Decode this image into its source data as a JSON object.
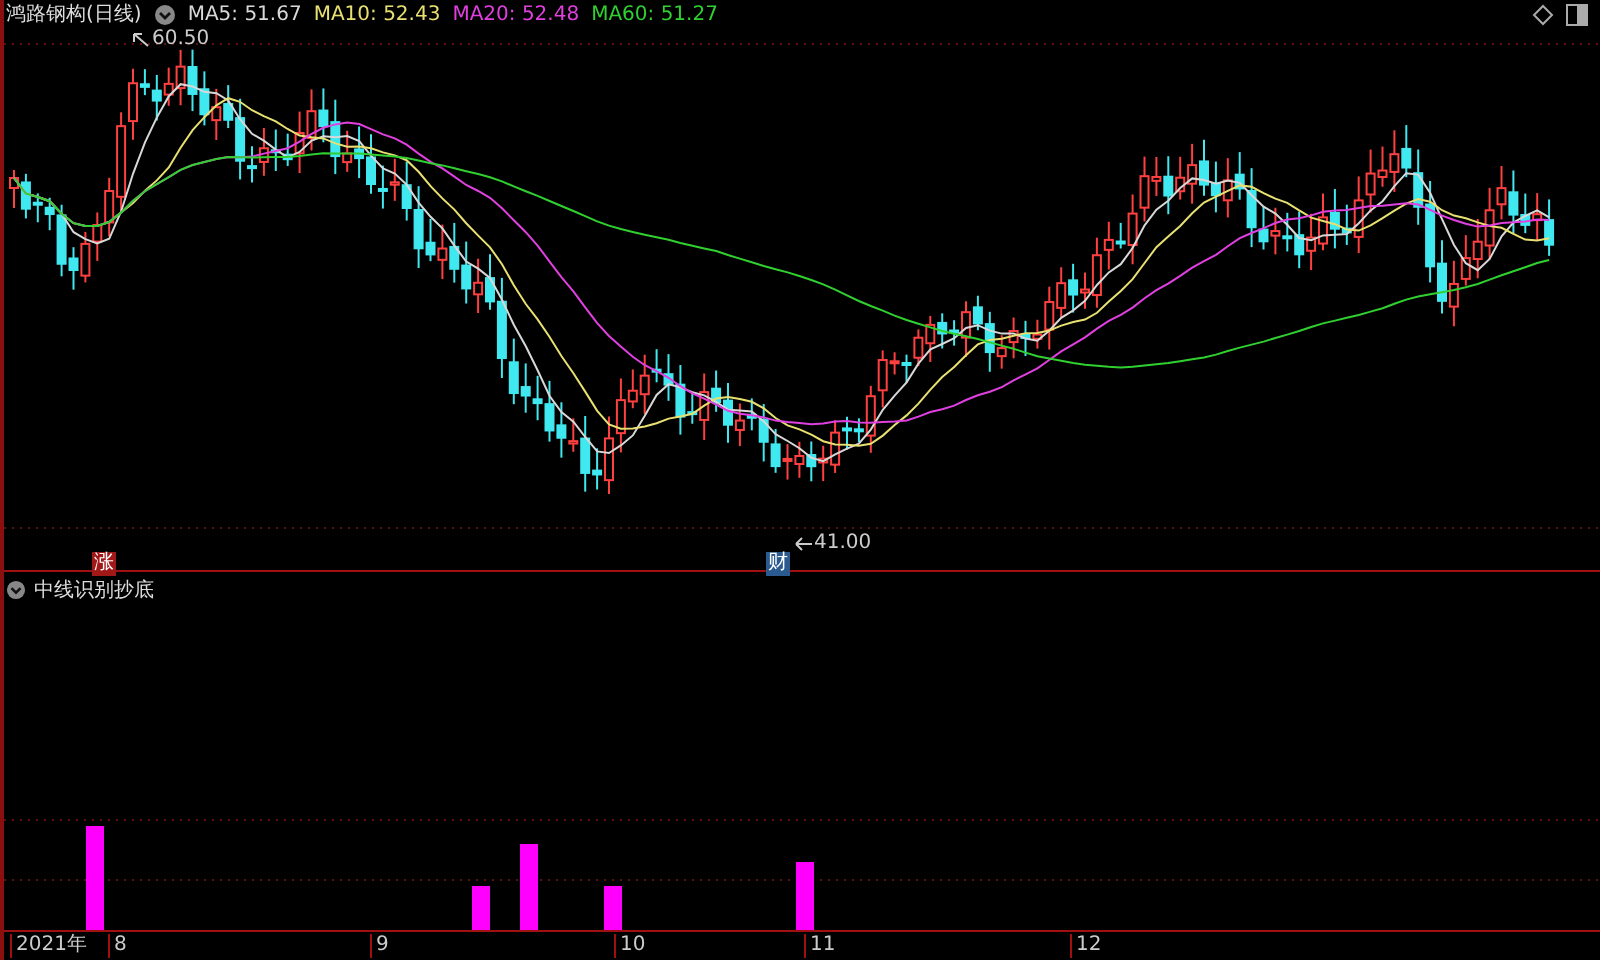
{
  "header": {
    "title": "鸿路钢构(日线)",
    "averages": [
      {
        "label": "MA5: 51.67",
        "color": "#d8d8d8"
      },
      {
        "label": "MA10: 52.43",
        "color": "#e8e070"
      },
      {
        "label": "MA20: 52.48",
        "color": "#e040e0"
      },
      {
        "label": "MA60: 51.27",
        "color": "#30d030"
      }
    ]
  },
  "price_chart": {
    "high_marker": "60.50",
    "low_marker": "41.00",
    "events": [
      {
        "label": "涨",
        "color": "#a01818"
      },
      {
        "label": "财",
        "color": "#2a5a90"
      }
    ]
  },
  "indicator": {
    "title": "中线识别抄底"
  },
  "x_axis": [
    "2021年",
    "8",
    "9",
    "10",
    "11",
    "12"
  ]
}
